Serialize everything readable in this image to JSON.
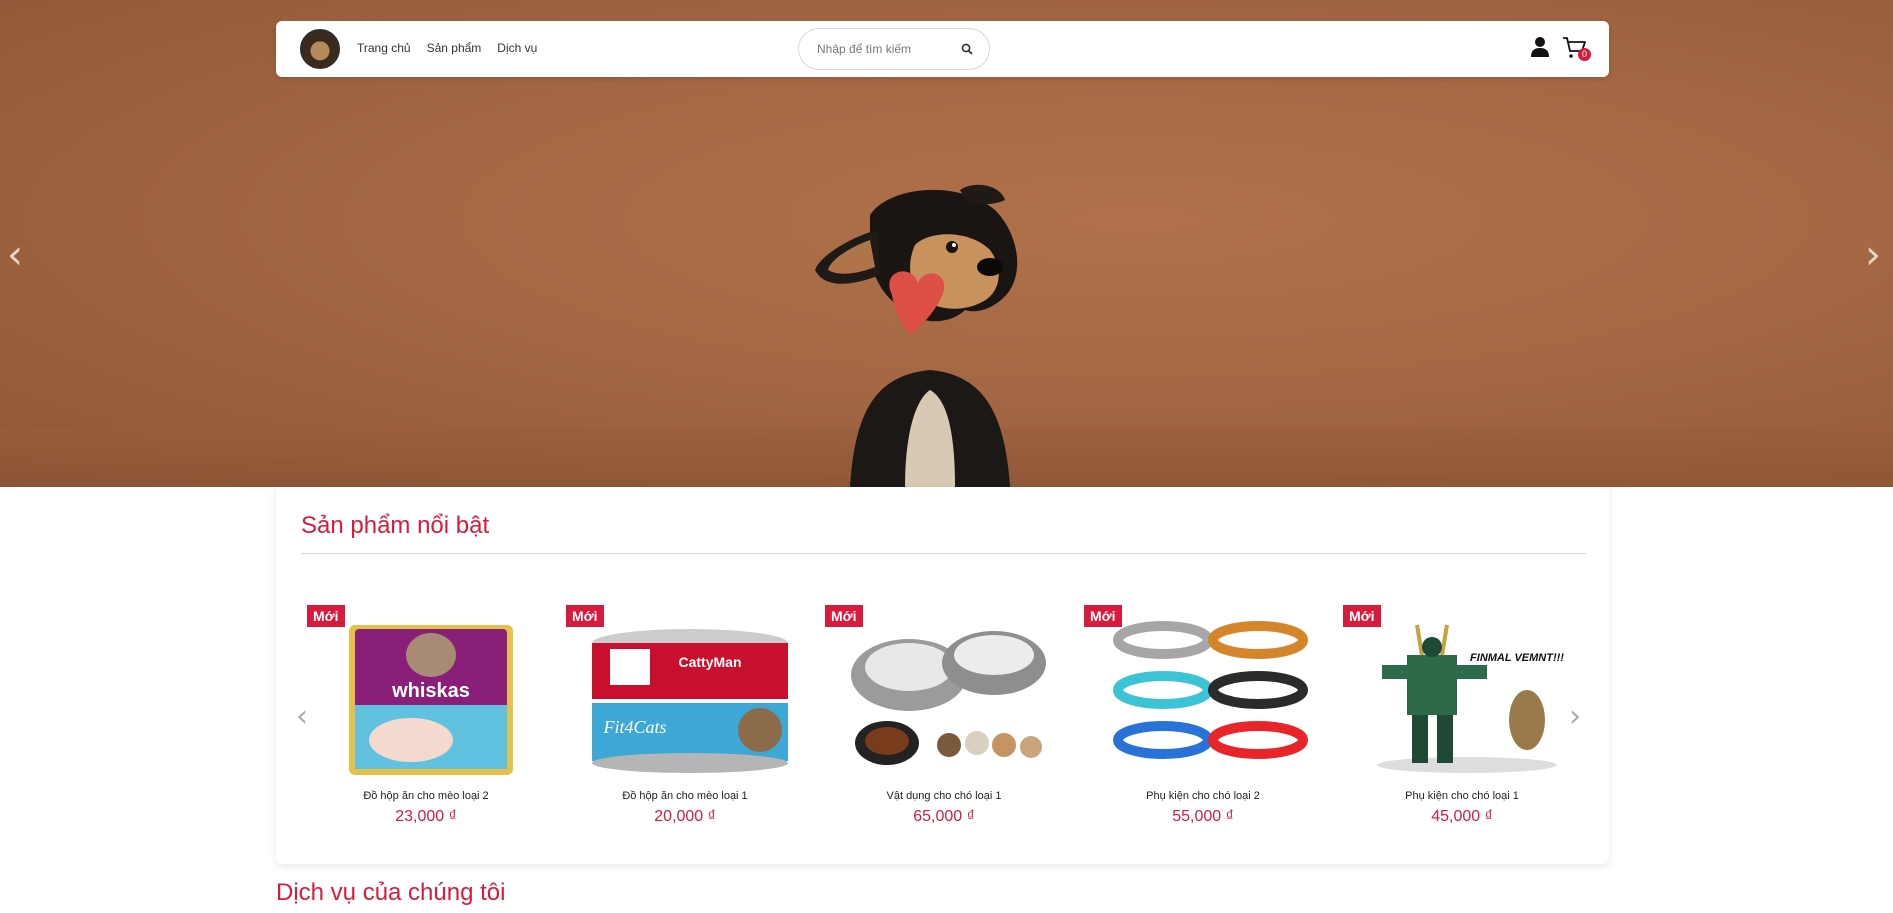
{
  "nav": {
    "links": [
      "Trang chủ",
      "Sản phẩm",
      "Dịch vụ"
    ],
    "search_placeholder": "Nhập để tìm kiếm",
    "cart_count": "0"
  },
  "hero": {
    "prev_arrow": "‹",
    "next_arrow": "›"
  },
  "featured": {
    "title": "Sản phẩm nổi bật",
    "prev_arrow": "‹",
    "next_arrow": "›",
    "products": [
      {
        "badge": "Mới",
        "name": "Đồ hộp ăn cho mèo loại 2",
        "price": "23,000 ₫"
      },
      {
        "badge": "Mới",
        "name": "Đồ hộp ăn cho mèo loại 1",
        "price": "20,000 ₫"
      },
      {
        "badge": "Mới",
        "name": "Vật dụng cho chó loại 1",
        "price": "65,000 ₫"
      },
      {
        "badge": "Mới",
        "name": "Phụ kiện cho chó loại 2",
        "price": "55,000 ₫"
      },
      {
        "badge": "Mới",
        "name": "Phụ kiện cho chó loại 1",
        "price": "45,000 ₫"
      }
    ]
  },
  "services": {
    "title": "Dịch vụ của chúng tôi"
  },
  "colors": {
    "accent": "#d81b3c",
    "hero_bg": "#a46844"
  }
}
